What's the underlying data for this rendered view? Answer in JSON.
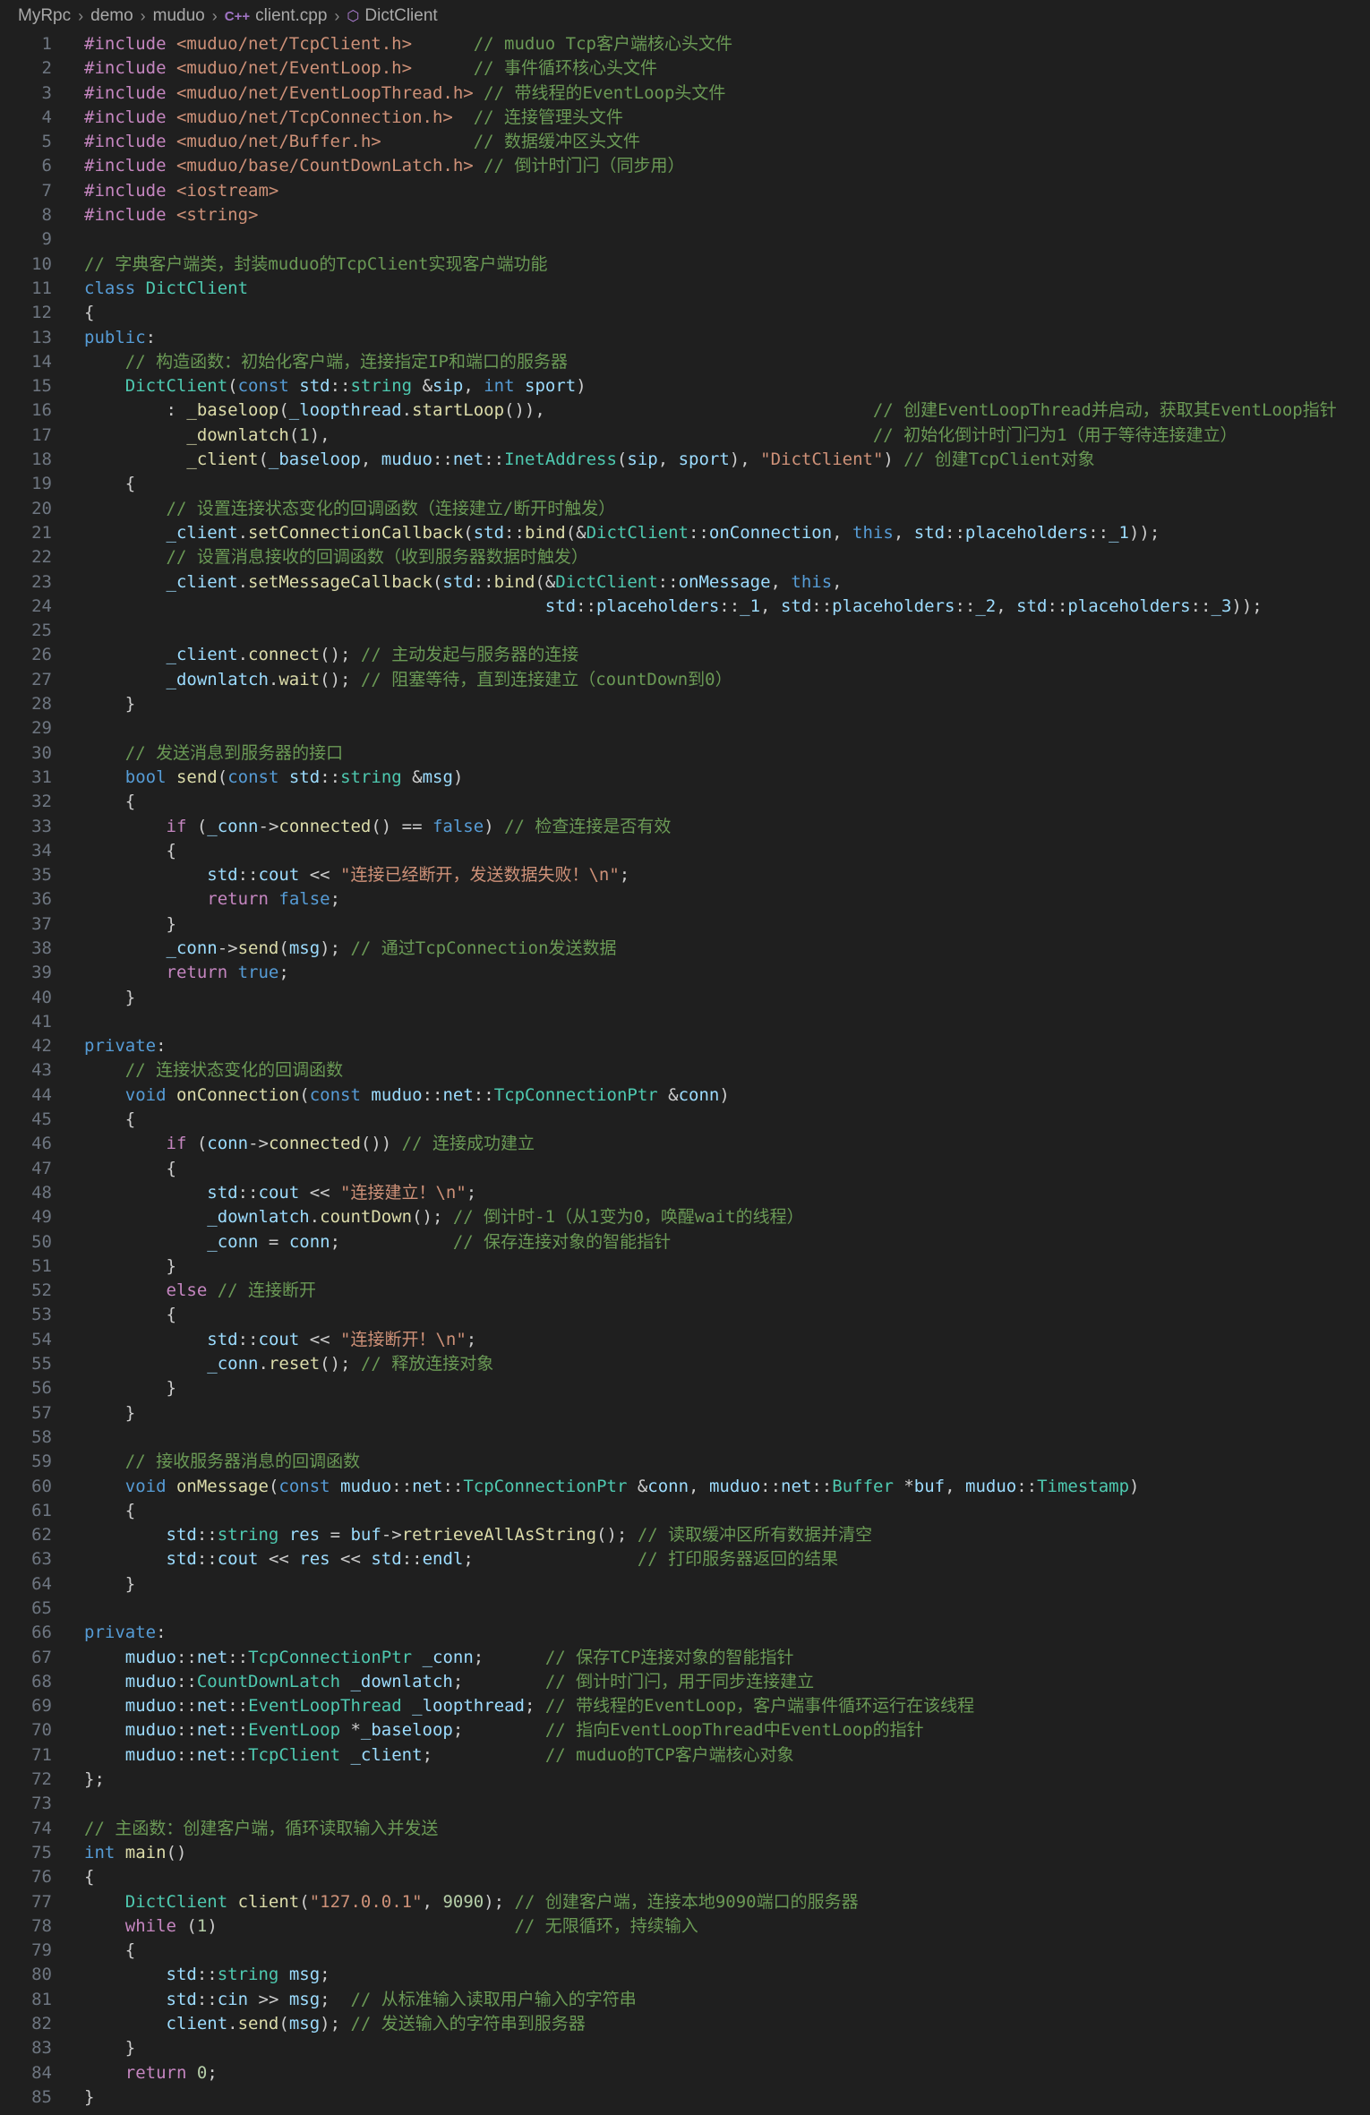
{
  "breadcrumb": {
    "items": [
      "MyRpc",
      "demo",
      "muduo",
      "client.cpp",
      "DictClient"
    ],
    "icons": {
      "file": "cpp-file-icon",
      "symbol": "class-symbol-icon"
    }
  },
  "colors": {
    "background": "#1f1f1f",
    "keyword": "#569cd6",
    "type": "#4ec9b0",
    "function": "#dcdcaa",
    "string": "#ce9178",
    "comment": "#6a9955"
  },
  "editor": {
    "lines": [
      "#include <muduo/net/TcpClient.h>      // muduo Tcp客户端核心头文件",
      "#include <muduo/net/EventLoop.h>      // 事件循环核心头文件",
      "#include <muduo/net/EventLoopThread.h> // 带线程的EventLoop头文件",
      "#include <muduo/net/TcpConnection.h>  // 连接管理头文件",
      "#include <muduo/net/Buffer.h>         // 数据缓冲区头文件",
      "#include <muduo/base/CountDownLatch.h> // 倒计时门闩（同步用）",
      "#include <iostream>",
      "#include <string>",
      "",
      "// 字典客户端类，封装muduo的TcpClient实现客户端功能",
      "class DictClient",
      "{",
      "public:",
      "    // 构造函数：初始化客户端，连接指定IP和端口的服务器",
      "    DictClient(const std::string &sip, int sport)",
      "        : _baseloop(_loopthread.startLoop()),                                // 创建EventLoopThread并启动，获取其EventLoop指针",
      "          _downlatch(1),                                                     // 初始化倒计时门闩为1（用于等待连接建立）",
      "          _client(_baseloop, muduo::net::InetAddress(sip, sport), \"DictClient\") // 创建TcpClient对象",
      "    {",
      "        // 设置连接状态变化的回调函数（连接建立/断开时触发）",
      "        _client.setConnectionCallback(std::bind(&DictClient::onConnection, this, std::placeholders::_1));",
      "        // 设置消息接收的回调函数（收到服务器数据时触发）",
      "        _client.setMessageCallback(std::bind(&DictClient::onMessage, this,",
      "                                             std::placeholders::_1, std::placeholders::_2, std::placeholders::_3));",
      "",
      "        _client.connect(); // 主动发起与服务器的连接",
      "        _downlatch.wait(); // 阻塞等待，直到连接建立（countDown到0）",
      "    }",
      "",
      "    // 发送消息到服务器的接口",
      "    bool send(const std::string &msg)",
      "    {",
      "        if (_conn->connected() == false) // 检查连接是否有效",
      "        {",
      "            std::cout << \"连接已经断开，发送数据失败！\\n\";",
      "            return false;",
      "        }",
      "        _conn->send(msg); // 通过TcpConnection发送数据",
      "        return true;",
      "    }",
      "",
      "private:",
      "    // 连接状态变化的回调函数",
      "    void onConnection(const muduo::net::TcpConnectionPtr &conn)",
      "    {",
      "        if (conn->connected()) // 连接成功建立",
      "        {",
      "            std::cout << \"连接建立！\\n\";",
      "            _downlatch.countDown(); // 倒计时-1（从1变为0，唤醒wait的线程）",
      "            _conn = conn;           // 保存连接对象的智能指针",
      "        }",
      "        else // 连接断开",
      "        {",
      "            std::cout << \"连接断开！\\n\";",
      "            _conn.reset(); // 释放连接对象",
      "        }",
      "    }",
      "",
      "    // 接收服务器消息的回调函数",
      "    void onMessage(const muduo::net::TcpConnectionPtr &conn, muduo::net::Buffer *buf, muduo::Timestamp)",
      "    {",
      "        std::string res = buf->retrieveAllAsString(); // 读取缓冲区所有数据并清空",
      "        std::cout << res << std::endl;                // 打印服务器返回的结果",
      "    }",
      "",
      "private:",
      "    muduo::net::TcpConnectionPtr _conn;      // 保存TCP连接对象的智能指针",
      "    muduo::CountDownLatch _downlatch;        // 倒计时门闩，用于同步连接建立",
      "    muduo::net::EventLoopThread _loopthread; // 带线程的EventLoop，客户端事件循环运行在该线程",
      "    muduo::net::EventLoop *_baseloop;        // 指向EventLoopThread中EventLoop的指针",
      "    muduo::net::TcpClient _client;           // muduo的TCP客户端核心对象",
      "};",
      "",
      "// 主函数：创建客户端，循环读取输入并发送",
      "int main()",
      "{",
      "    DictClient client(\"127.0.0.1\", 9090); // 创建客户端，连接本地9090端口的服务器",
      "    while (1)                             // 无限循环，持续输入",
      "    {",
      "        std::string msg;",
      "        std::cin >> msg;  // 从标准输入读取用户输入的字符串",
      "        client.send(msg); // 发送输入的字符串到服务器",
      "    }",
      "    return 0;",
      "}"
    ]
  }
}
